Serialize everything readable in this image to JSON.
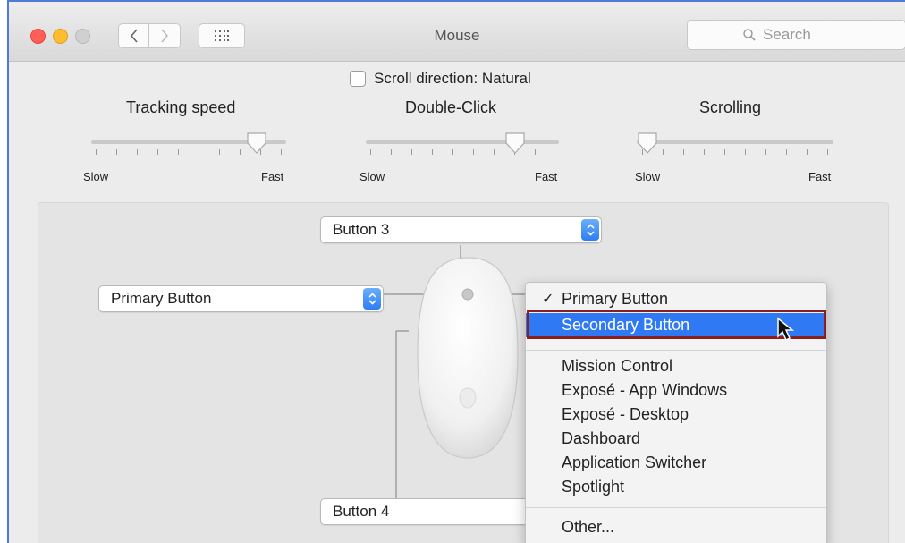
{
  "window": {
    "title": "Mouse",
    "search_placeholder": "Search"
  },
  "options": {
    "scroll_direction_label": "Scroll direction: Natural",
    "scroll_direction_checked": false
  },
  "sliders": [
    {
      "label": "Tracking speed",
      "min_label": "Slow",
      "max_label": "Fast",
      "value_fraction": 0.85
    },
    {
      "label": "Double-Click",
      "min_label": "Slow",
      "max_label": "Fast",
      "value_fraction": 0.75
    },
    {
      "label": "Scrolling",
      "min_label": "Slow",
      "max_label": "Fast",
      "value_fraction": 0.07
    }
  ],
  "buttons_panel": {
    "top_popup": "Button 3",
    "left_popup": "Primary Button",
    "bottom_popup": "Button 4"
  },
  "dropdown_menu": {
    "checked_item": "Primary Button",
    "selected_item": "Secondary Button",
    "items": [
      "Mission Control",
      "Exposé - App Windows",
      "Exposé - Desktop",
      "Dashboard",
      "Application Switcher",
      "Spotlight"
    ],
    "other_item": "Other..."
  },
  "colors": {
    "selection": "#2f79f4",
    "highlight_frame": "#8a1f1f",
    "close": "#ff5f57",
    "minimize": "#febc2e"
  }
}
